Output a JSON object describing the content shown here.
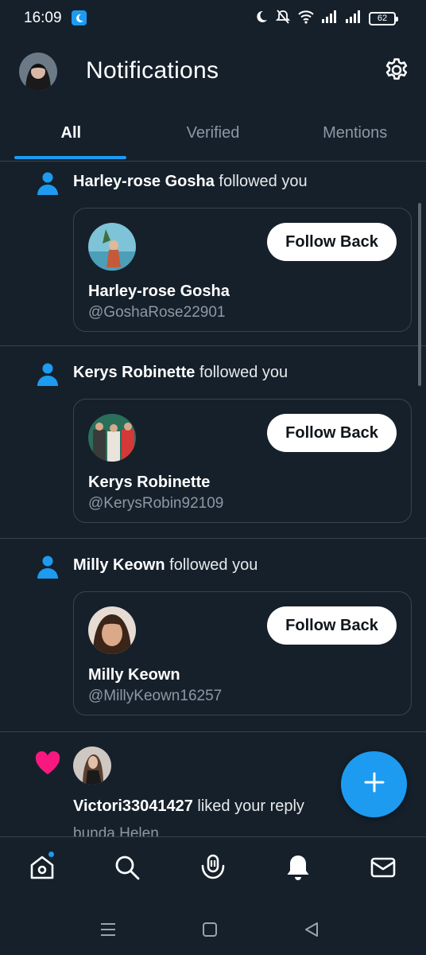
{
  "status_bar": {
    "time": "16:09",
    "battery": "62",
    "icons": [
      "moon-icon",
      "mute-icon",
      "wifi-icon",
      "signal-icon",
      "signal-icon",
      "battery-icon"
    ]
  },
  "header": {
    "title": "Notifications",
    "settings_icon": "gear-icon"
  },
  "tabs": [
    {
      "label": "All",
      "active": true
    },
    {
      "label": "Verified",
      "active": false
    },
    {
      "label": "Mentions",
      "active": false
    }
  ],
  "notifications": [
    {
      "type": "follow",
      "icon": "person-icon",
      "actor": "Harley-rose Gosha",
      "action": "followed you",
      "card": {
        "name": "Harley-rose Gosha",
        "handle": "@GoshaRose22901",
        "button": "Follow Back"
      }
    },
    {
      "type": "follow",
      "icon": "person-icon",
      "actor": "Kerys Robinette",
      "action": "followed you",
      "card": {
        "name": "Kerys Robinette",
        "handle": "@KerysRobin92109",
        "button": "Follow Back"
      }
    },
    {
      "type": "follow",
      "icon": "person-icon",
      "actor": "Milly Keown",
      "action": "followed you",
      "card": {
        "name": "Milly Keown",
        "handle": "@MillyKeown16257",
        "button": "Follow Back"
      }
    },
    {
      "type": "like",
      "icon": "heart-icon",
      "actor": "Victori33041427",
      "action": "liked your reply",
      "snippet": "bunda Helen"
    }
  ],
  "bottom_nav": [
    {
      "name": "home",
      "icon": "home-icon",
      "badge": true
    },
    {
      "name": "search",
      "icon": "search-icon",
      "badge": false
    },
    {
      "name": "spaces",
      "icon": "spaces-icon",
      "badge": false
    },
    {
      "name": "notifications",
      "icon": "bell-icon",
      "badge": false
    },
    {
      "name": "messages",
      "icon": "mail-icon",
      "badge": false
    }
  ],
  "colors": {
    "background": "#15202b",
    "accent": "#1d9bf0",
    "like": "#f91880",
    "divider": "#38444d",
    "muted_text": "#8b98a5"
  }
}
